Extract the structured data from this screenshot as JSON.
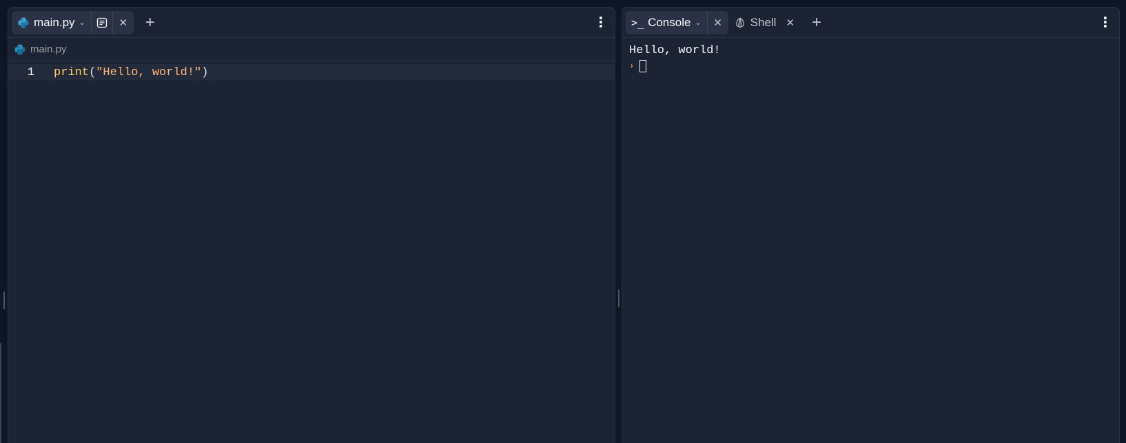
{
  "editor": {
    "tabs": [
      {
        "label": "main.py",
        "icon": "python-icon",
        "active": true
      }
    ],
    "add_tab_label": "+",
    "breadcrumb": "main.py",
    "code_lines": [
      {
        "number": "1",
        "fn": "print",
        "open": "(",
        "str": "\"Hello, world!\"",
        "close": ")"
      }
    ]
  },
  "console_pane": {
    "tabs": [
      {
        "label": "Console",
        "icon": "terminal-icon",
        "active": true
      },
      {
        "label": "Shell",
        "icon": "shell-icon",
        "active": false
      }
    ],
    "output_lines": [
      "Hello, world!"
    ],
    "prompt_glyph": "›"
  },
  "colors": {
    "background": "#0e1525",
    "pane": "#1c2333",
    "tab_active": "#2b3245",
    "string": "#ffb878",
    "function": "#ffcf60",
    "prompt": "#e5a234"
  }
}
